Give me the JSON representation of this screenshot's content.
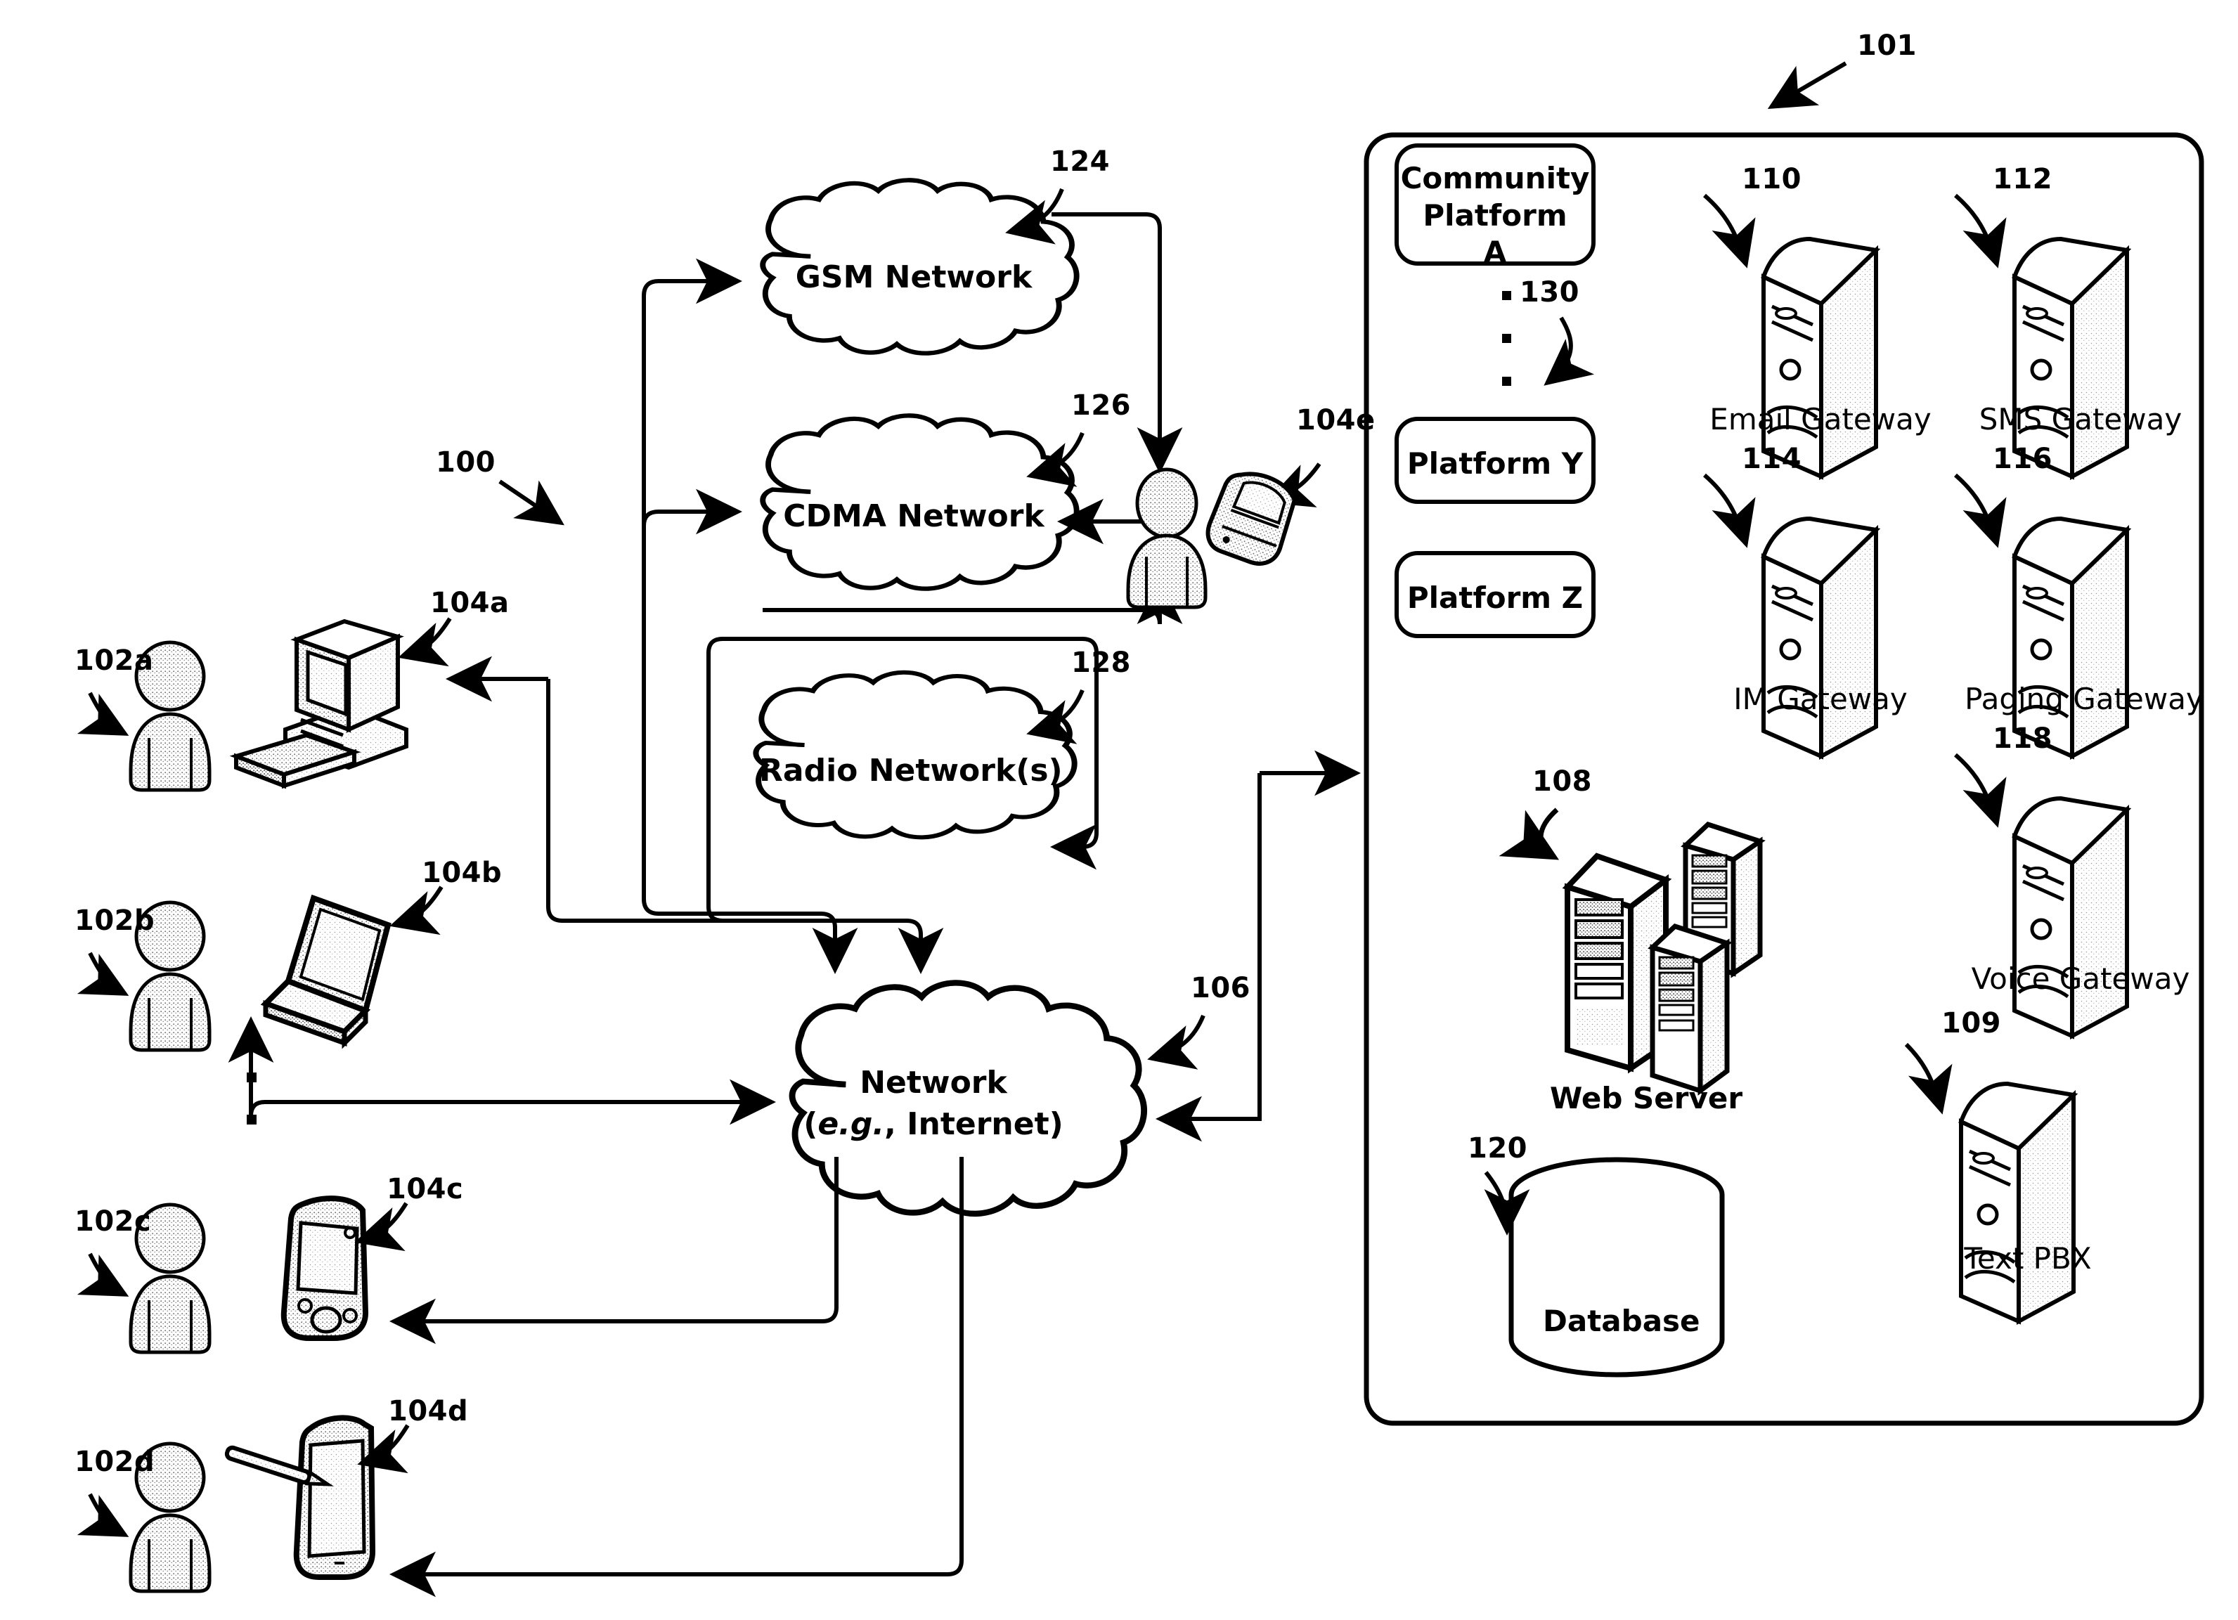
{
  "figure": {
    "system_ref": "100",
    "panel_ref": "101"
  },
  "users": [
    {
      "ref": "102a",
      "device_ref": "104a",
      "device": "desktop-computer"
    },
    {
      "ref": "102b",
      "device_ref": "104b",
      "device": "laptop-computer"
    },
    {
      "ref": "102c",
      "device_ref": "104c",
      "device": "pda-handheld"
    },
    {
      "ref": "102d",
      "device_ref": "104d",
      "device": "tablet-stylus"
    }
  ],
  "mobile_user": {
    "device_ref": "104e",
    "device": "flip-phone"
  },
  "networks": [
    {
      "ref": "124",
      "label": "GSM Network"
    },
    {
      "ref": "126",
      "label": "CDMA Network"
    },
    {
      "ref": "128",
      "label": "Radio Network(s)"
    }
  ],
  "internet": {
    "ref": "106",
    "line1": "Network",
    "line2_prefix": "(",
    "line2_italic": "e.g.",
    "line2_suffix": ", Internet)"
  },
  "platforms": {
    "ellipsis_ref": "130",
    "items": [
      {
        "line1": "Community",
        "line2": "Platform",
        "line3": "A"
      },
      {
        "line1": "Platform Y"
      },
      {
        "line1": "Platform Z"
      }
    ]
  },
  "gateways": [
    {
      "ref": "110",
      "label": "Email Gateway"
    },
    {
      "ref": "112",
      "label": "SMS Gateway"
    },
    {
      "ref": "114",
      "label": "IM  Gateway"
    },
    {
      "ref": "116",
      "label": "Paging Gateway"
    },
    {
      "ref": "118",
      "label": "Voice Gateway"
    },
    {
      "ref": "109",
      "label": "Text PBX"
    }
  ],
  "web_server": {
    "ref": "108",
    "label": "Web Server"
  },
  "database": {
    "ref": "120",
    "label": "Database"
  }
}
